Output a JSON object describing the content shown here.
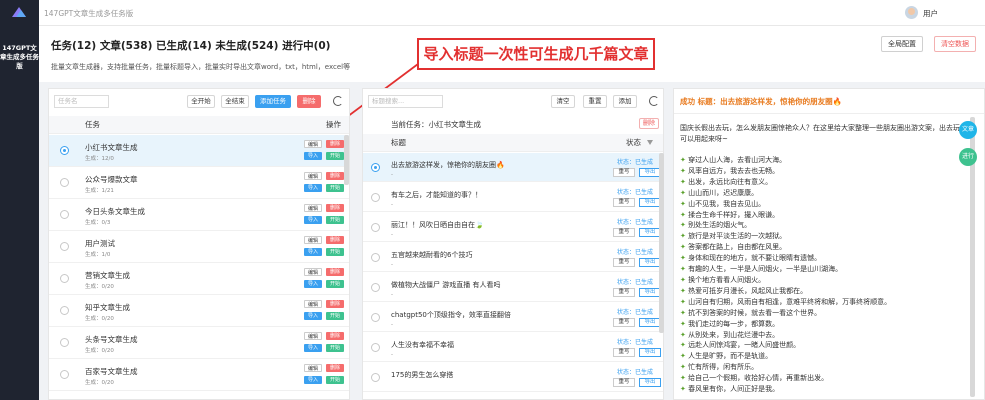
{
  "app": {
    "window_title": "147GPT文章生成多任务版",
    "rail_title": "147GPT文章生成多任务版",
    "user_label": "用户"
  },
  "header": {
    "stats": "任务(12) 文章(538) 已生成(14) 未生成(524) 进行中(0)",
    "description": "批量文章生成器，支持批量任务，批量标题导入，批量实时导出文章word，txt，html，excel等",
    "btn_global_config": "全局配置",
    "btn_clear_data": "清空数据"
  },
  "callout": {
    "text": "导入标题一次性可生成几千篇文章",
    "color": "#e23030"
  },
  "task_panel": {
    "search_placeholder": "任务名",
    "btn_start_all": "全开始",
    "btn_stop_all": "全结束",
    "btn_add_task": "添加任务",
    "btn_delete": "删除",
    "col_task": "任务",
    "col_ops": "操作",
    "op_edit": "编辑",
    "op_delete": "删除",
    "op_import": "导入",
    "op_start": "开始",
    "tasks": [
      {
        "name": "小红书文章生成",
        "sub": "生成：12/0",
        "active": true
      },
      {
        "name": "公众号爆款文章",
        "sub": "生成：1/21",
        "active": false
      },
      {
        "name": "今日头条文章生成",
        "sub": "生成：0/3",
        "active": false
      },
      {
        "name": "用户测试",
        "sub": "生成：1/0",
        "active": false
      },
      {
        "name": "营销文章生成",
        "sub": "生成：0/20",
        "active": false
      },
      {
        "name": "知乎文章生成",
        "sub": "生成：0/20",
        "active": false
      },
      {
        "name": "头条号文章生成",
        "sub": "生成：0/20",
        "active": false
      },
      {
        "name": "百家号文章生成",
        "sub": "生成：0/20",
        "active": false
      }
    ]
  },
  "article_panel": {
    "search_placeholder": "标题搜索...",
    "btn_clear": "清空",
    "btn_reset": "重置",
    "btn_add": "添加",
    "current_task": "当前任务：小红书文章生成",
    "btn_delete": "删除",
    "col_title": "标题",
    "col_status": "状态",
    "btn_rewrite": "重写",
    "btn_export": "导出",
    "articles": [
      {
        "title": "出去旅游这样发，惊艳你的朋友圈🔥",
        "sub": "-",
        "status": "状态：已生成",
        "active": true
      },
      {
        "title": "有车之后，才能知道的事？！",
        "sub": "-",
        "status": "状态：已生成",
        "active": false
      },
      {
        "title": "丽江！！风吹日晒自由自在🍃",
        "sub": "-",
        "status": "状态：已生成",
        "active": false
      },
      {
        "title": "五官越来越耐看的6个技巧",
        "sub": "-",
        "status": "状态：已生成",
        "active": false
      },
      {
        "title": "做植物大战僵尸 游戏直播 有人看吗",
        "sub": "-",
        "status": "状态：已生成",
        "active": false
      },
      {
        "title": "chatgpt50个顶级指令，效率直接翻倍",
        "sub": "-",
        "status": "状态：已生成",
        "active": false
      },
      {
        "title": "人生没有幸福不幸福",
        "sub": "-",
        "status": "状态：已生成",
        "active": false
      },
      {
        "title": "175的男生怎么穿搭",
        "sub": "",
        "status": "状态：已生成",
        "active": false
      }
    ]
  },
  "content_panel": {
    "header": "成功 标题：出去旅游这样发，惊艳你的朋友圈🔥",
    "intro": "国庆长假出去玩，怎么发朋友圈惊艳众人？在这里给大家整理一些朋友圈出游文案，出去玩可以用起来呀~",
    "lines": [
      "穿过人山人海，去看山河大海。",
      "风率自远方，我去去也无畅。",
      "出发，永远比向往有意义。",
      "山山而川，迟迟康康。",
      "山不见我，我自去见山。",
      "揉合生命千样好，撮入眼谦。",
      "别处生活的烟火气。",
      "旅行是对平淡生活的一次越狱。",
      "答案都在路上，自由都在风里。",
      "身体和现在的地方，就不要让眼睛有遗憾。",
      "有趣的人生，一半是人间烟火，一半是山川湖海。",
      "换个地方看看人间烟火。",
      "热爱可抵岁月漫长，风起风止我都在。",
      "山河自有归期，风雨自有相逢，意难平终将和解，万事终将顺意。",
      "抗不到答案的时候，就去看一看这个世界。",
      "我们走过的每一步，都算数。",
      "从别处来，到山花烂漫中去。",
      "远赴人间惊鸿宴，一睹人间盛世颜。",
      "人生是旷野，而不是轨道。",
      "忙有所得，闲有所乐。",
      "给自己一个假期，收拾好心情，再重新出发。",
      "春风里有你，人间正好是我。"
    ]
  },
  "floating": {
    "btn_article": "文章",
    "btn_progress": "进行"
  }
}
